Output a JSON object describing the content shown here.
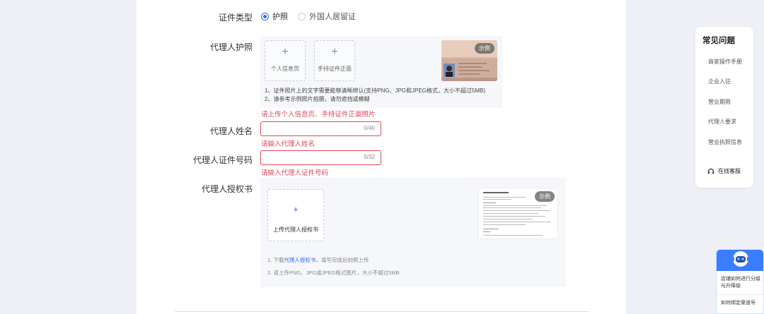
{
  "form": {
    "id_type_label": "证件类型",
    "id_type_options": [
      "护照",
      "外国人居留证"
    ],
    "passport_label": "代理人护照",
    "passport_upload_1": "个人信息页",
    "passport_upload_2": "手持证件正面",
    "sample_badge": "示例",
    "passport_tip_1": "1、证件照片上的文字需要能够清晰辨认(支持PNG、JPG和JPEG格式，大小不超过5MB)",
    "passport_tip_2": "2、请参考示例照片拍摄，请勿遮挡或模糊",
    "passport_error": "请上传个人信息页、手持证件正面照片",
    "name_label": "代理人姓名",
    "name_value": "",
    "name_count": "0/40",
    "name_error": "请输入代理人姓名",
    "idno_label": "代理人证件号码",
    "idno_value": "",
    "idno_count": "0/32",
    "idno_error": "请输入代理人证件号码",
    "auth_label": "代理人授权书",
    "auth_upload": "上传代理人授权书",
    "auth_tip_1_pre": "1. 下载",
    "auth_tip_1_link": "代理人授权书",
    "auth_tip_1_post": "，填写完成后拍照上传",
    "auth_tip_2": "2. 请上传PNG、JPG或JPEG格式图片，大小不超过5MB"
  },
  "faq": {
    "title": "常见问题",
    "items": [
      "商家操作手册",
      "企业入驻",
      "营业期限",
      "代理人要求",
      "营业执照信息"
    ],
    "service": "在线客服"
  },
  "help": {
    "q1": "店铺如何进行分级与升降级",
    "q2": "如何绑定渠道号"
  },
  "colors": {
    "accent": "#2f6bff",
    "error": "#e0455b",
    "background": "#eef0f5"
  }
}
